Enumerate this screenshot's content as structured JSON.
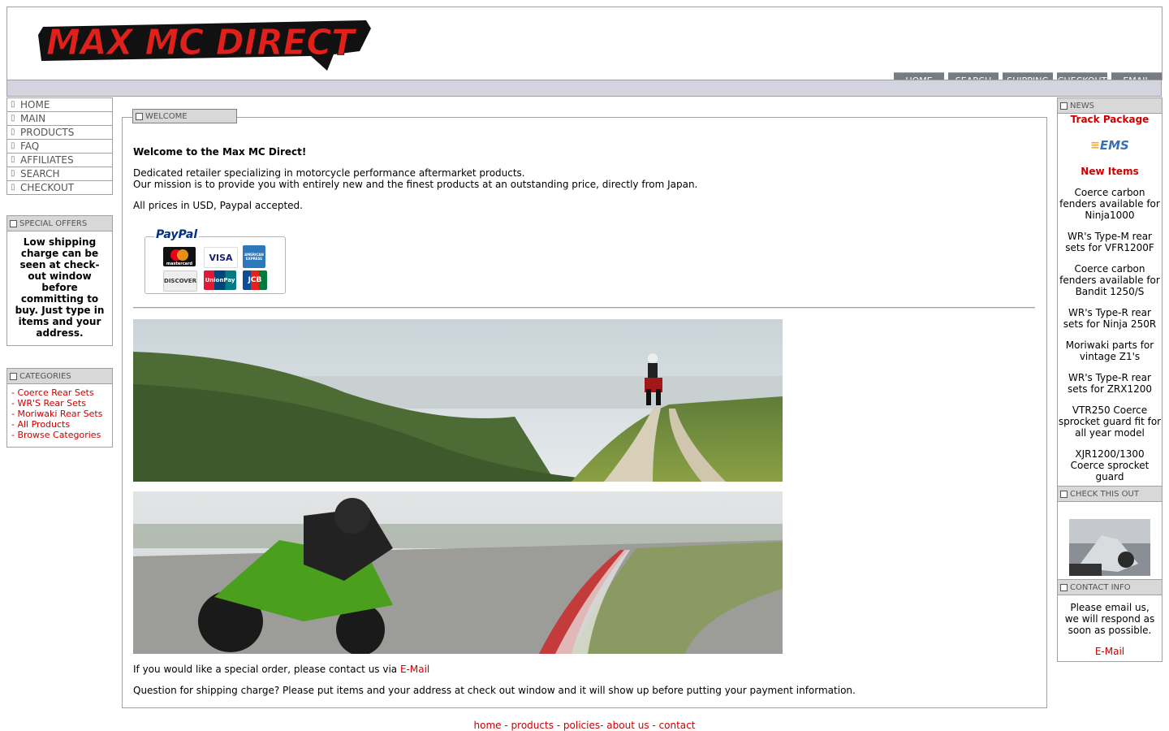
{
  "site": {
    "logo_text": "MAX MC DIRECT"
  },
  "topnav": [
    "HOME",
    "SEARCH",
    "SHIPPING",
    "CHECKOUT",
    "EMAIL"
  ],
  "leftnav": [
    "HOME",
    "MAIN",
    "PRODUCTS",
    "FAQ",
    "AFFILIATES",
    "SEARCH",
    "CHECKOUT"
  ],
  "special_offers": {
    "title": "SPECIAL OFFERS",
    "text": "Low shipping charge can be seen at check-out window before committing to buy. Just type in items and your address."
  },
  "categories": {
    "title": "CATEGORIES",
    "items": [
      "- Coerce Rear Sets",
      "- WR'S Rear Sets",
      "- Moriwaki Rear Sets",
      "- All Products",
      "- Browse Categories"
    ]
  },
  "welcome": {
    "tab": "WELCOME",
    "heading": "Welcome to the Max MC Direct!",
    "line1": "Dedicated retailer specializing in motorcycle performance aftermarket products.",
    "line2": "Our mission is to provide you with entirely new and the finest products at an outstanding price, directly from Japan.",
    "line3": "All prices in USD, Paypal accepted.",
    "paypal": "PayPal",
    "cards": [
      "mastercard",
      "VISA",
      "AMERICAN EXPRESS",
      "DISCOVER",
      "UnionPay",
      "JCB"
    ],
    "special_order_prefix": "If you would like a special order, please contact us via ",
    "special_order_link": "E-Mail",
    "shipping_question": "Question for shipping charge? Please put items and your address at check out window and it will show up before putting your payment information."
  },
  "news": {
    "title": "NEWS",
    "track": "Track Package",
    "ems": "EMS",
    "new_items": "New Items",
    "items": [
      "Coerce carbon fenders available for Ninja1000",
      "WR's Type-M rear sets for VFR1200F",
      "Coerce carbon fenders available for Bandit 1250/S",
      "WR's Type-R rear sets for Ninja 250R",
      "Moriwaki parts for vintage Z1's",
      "WR's Type-R rear sets for ZRX1200",
      "VTR250 Coerce sprocket guard fit for all year model",
      "XJR1200/1300 Coerce sprocket guard"
    ]
  },
  "check_this_out": {
    "title": "CHECK THIS OUT"
  },
  "contact": {
    "title": "CONTACT INFO",
    "text": "Please email us, we will respond as soon as possible.",
    "link": "E-Mail"
  },
  "footer": {
    "home": "home",
    "products": "products",
    "policies": "policies",
    "about": "about us",
    "contact": "contact"
  },
  "colors": {
    "brand_red": "#cc0000",
    "nav_gray": "#767c84",
    "bar": "#d4d4e0"
  }
}
